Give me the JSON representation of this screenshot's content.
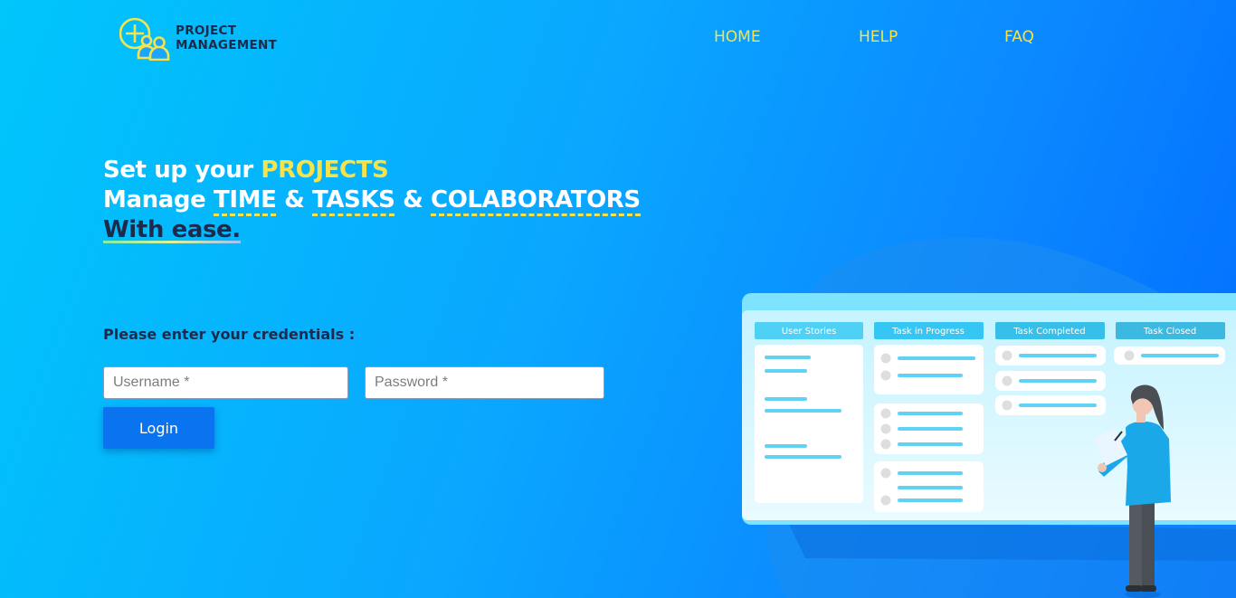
{
  "header": {
    "logo": {
      "line1": "PROJECT",
      "line2": "MANAGEMENT",
      "icon": "team-plus-icon"
    },
    "nav": [
      {
        "label": "HOME"
      },
      {
        "label": "HELP"
      },
      {
        "label": "FAQ"
      }
    ]
  },
  "hero": {
    "line1_prefix": "Set up your ",
    "line1_highlight": "PROJECTS",
    "line2_prefix": "Manage ",
    "line2_word1": "TIME",
    "line2_sep1": " & ",
    "line2_word2": "TASKS",
    "line2_sep2": " & ",
    "line2_word3": "COLABORATORS",
    "line3": "With ease."
  },
  "login": {
    "prompt": "Please enter your credentials :",
    "username_placeholder": "Username *",
    "password_placeholder": "Password *",
    "submit_label": "Login"
  },
  "board": {
    "columns": [
      {
        "title": "User Stories"
      },
      {
        "title": "Task in Progress"
      },
      {
        "title": "Task Completed"
      },
      {
        "title": "Task Closed"
      }
    ]
  },
  "colors": {
    "accent_yellow": "#f6e34a",
    "dark_text": "#1e2a4a",
    "button_blue": "#0a73f0"
  }
}
